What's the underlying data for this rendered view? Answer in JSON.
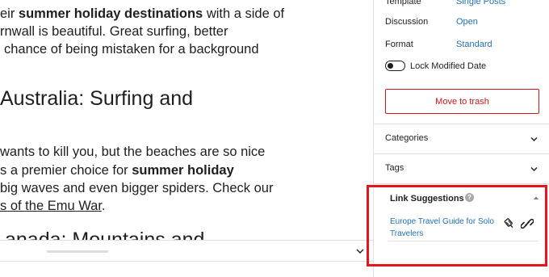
{
  "editor": {
    "paragraphs": [
      {
        "before": "eir ",
        "bold": "summer holiday destinations",
        "after": " with a side of"
      },
      {
        "text": "rnwall is beautiful. Great surfing, better"
      },
      {
        "text": "chance of being mistaken for a background"
      },
      {
        "text": "wants to kill you, but the beaches are so nice"
      },
      {
        "before": "s a premier choice for ",
        "bold": "summer holiday"
      },
      {
        "text": "big waves and even bigger spiders. Check our"
      },
      {
        "link": "s of the Emu War",
        "after": "."
      }
    ],
    "headings": [
      "Australia: Surfing and",
      "anada: Mountains and"
    ]
  },
  "sidebar": {
    "meta": [
      {
        "label": "Template",
        "value": "Single Posts"
      },
      {
        "label": "Discussion",
        "value": "Open"
      },
      {
        "label": "Format",
        "value": "Standard"
      }
    ],
    "lock_modified_date": {
      "label": "Lock Modified Date",
      "enabled": false
    },
    "trash_button": "Move to trash",
    "panels": [
      "Categories",
      "Tags"
    ],
    "link_suggestions": {
      "title": "Link Suggestions",
      "help": "?",
      "items": [
        {
          "title": "Europe Travel Guide for Solo Travelers"
        }
      ]
    }
  },
  "colors": {
    "link": "#2271b1",
    "danger": "#cc1818",
    "highlight": "#e8141b"
  }
}
